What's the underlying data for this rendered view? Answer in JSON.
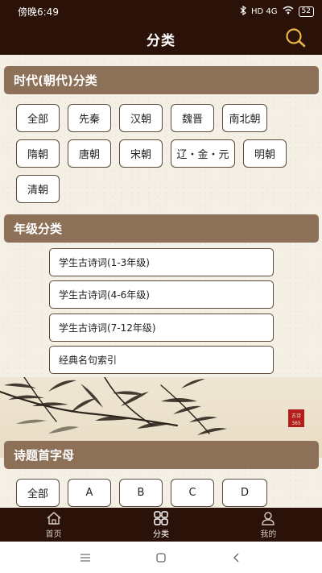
{
  "status": {
    "time": "傍晚6:49",
    "network": "HD 4G",
    "battery": "52"
  },
  "header": {
    "title": "分类"
  },
  "sections": {
    "dynasty": {
      "title": "时代(朝代)分类",
      "items": [
        "全部",
        "先秦",
        "汉朝",
        "魏晋",
        "南北朝",
        "隋朝",
        "唐朝",
        "宋朝",
        "辽・金・元",
        "明朝",
        "清朝"
      ]
    },
    "grade": {
      "title": "年级分类",
      "items": [
        "学生古诗词(1-3年级)",
        "学生古诗词(4-6年级)",
        "学生古诗词(7-12年级)",
        "经典名句索引"
      ]
    },
    "initial": {
      "title": "诗题首字母",
      "items": [
        "全部",
        "A",
        "B",
        "C",
        "D"
      ]
    }
  },
  "banner": {
    "seal_text": "古诗365"
  },
  "tabs": [
    {
      "label": "首页",
      "icon": "home-icon",
      "active": false
    },
    {
      "label": "分类",
      "icon": "grid-icon",
      "active": true
    },
    {
      "label": "我的",
      "icon": "user-icon",
      "active": false
    }
  ],
  "colors": {
    "bar": "#2a1208",
    "section_header": "#8c7057",
    "background": "#f4f0e6",
    "seal": "#b01e1e"
  }
}
